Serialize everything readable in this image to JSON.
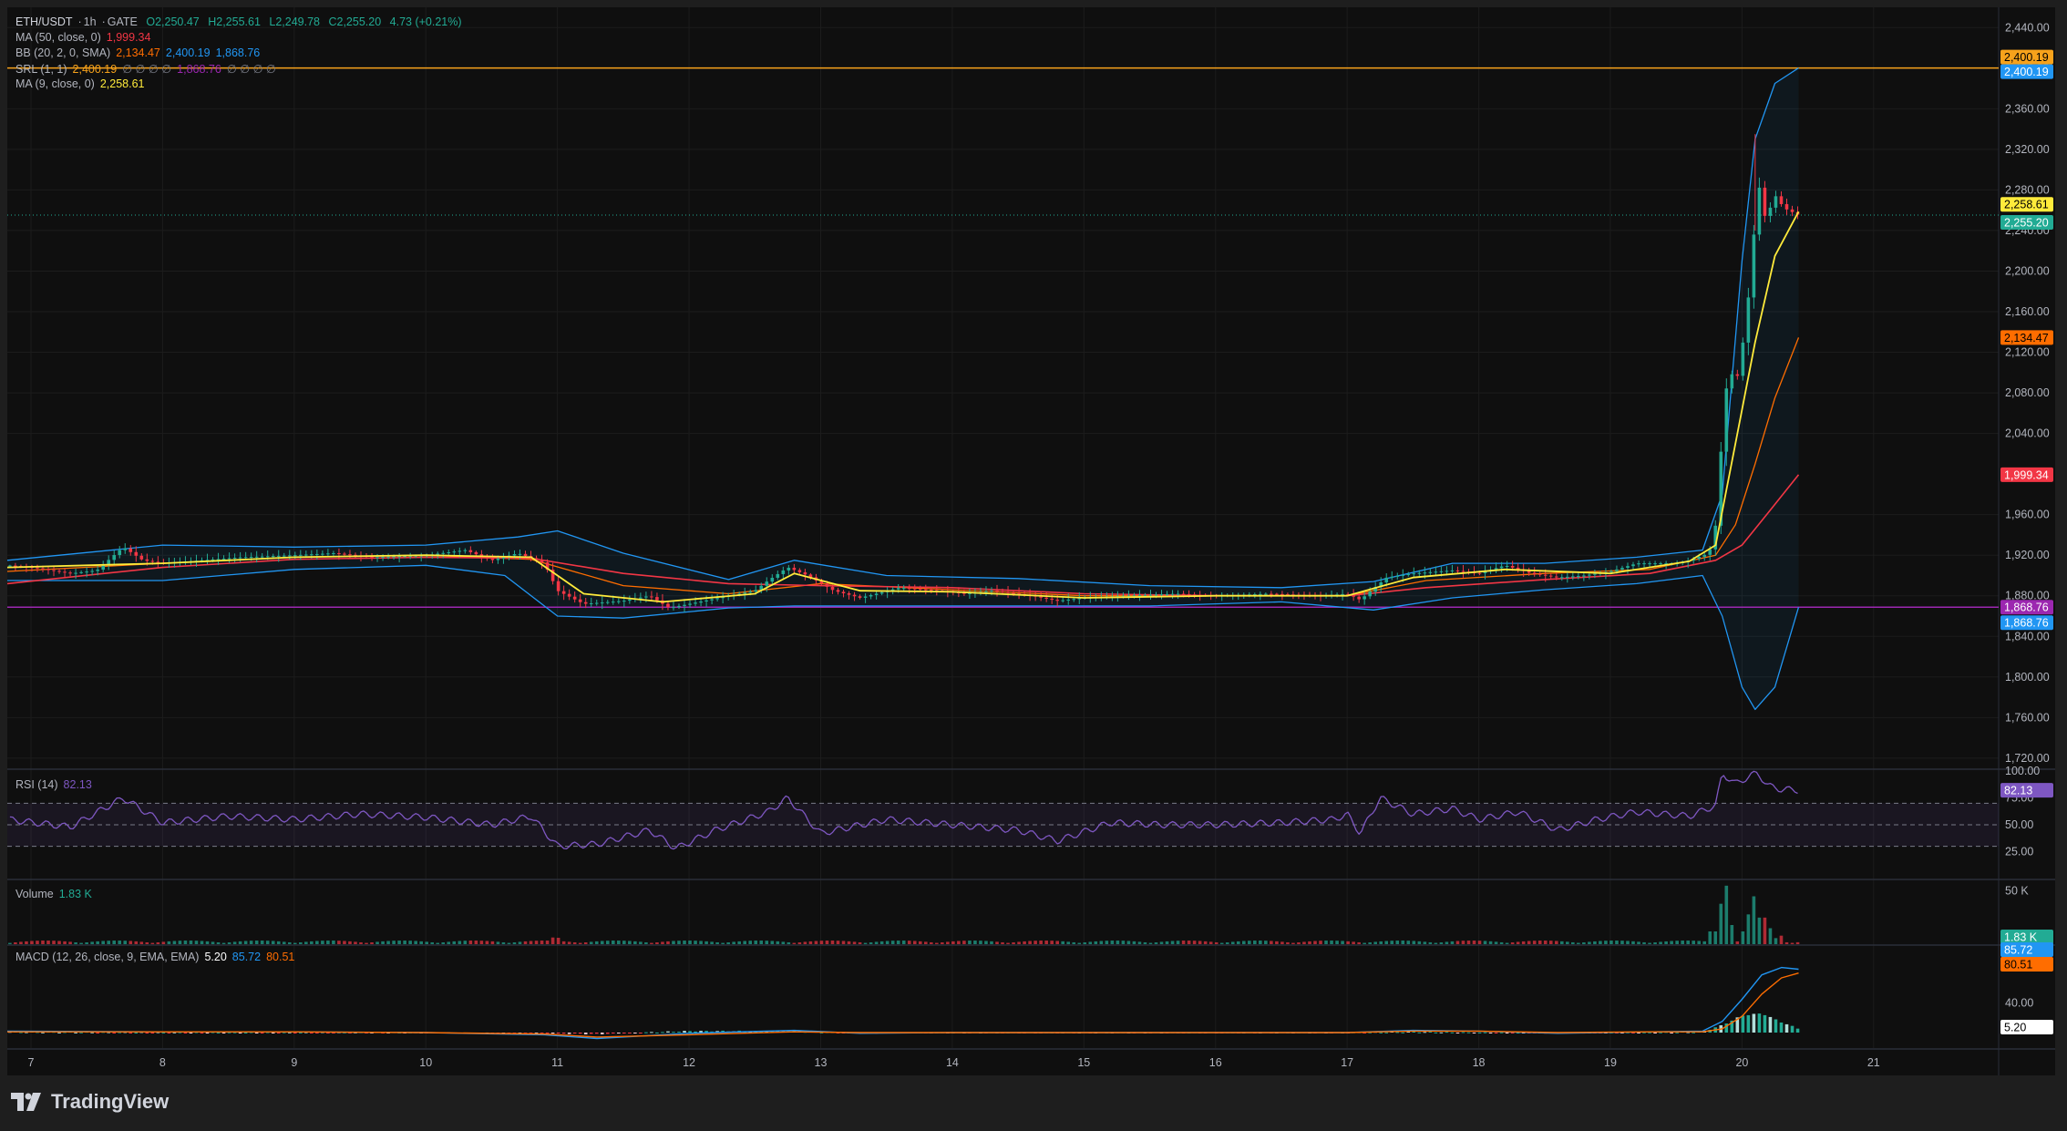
{
  "header": {
    "symbol": "ETH/USDT",
    "interval": "1h",
    "exchange": "GATE",
    "open": "O2,250.47",
    "high": "H2,255.61",
    "low": "L2,249.78",
    "close": "C2,255.20",
    "change": "4.73 (+0.21%)"
  },
  "indicators": {
    "ma50": {
      "label": "MA (50, close, 0)",
      "value": "1,999.34"
    },
    "bb": {
      "label": "BB (20, 2, 0, SMA)",
      "basis": "2,134.47",
      "upper": "2,400.19",
      "lower": "1,868.76"
    },
    "srl": {
      "label": "SRL (1, 1)",
      "v1": "2,400.19",
      "zeros1": "∅ ∅ ∅ ∅",
      "v2": "1,868.76",
      "zeros2": "∅ ∅ ∅ ∅"
    },
    "ma9": {
      "label": "MA (9, close, 0)",
      "value": "2,258.61"
    }
  },
  "rsi": {
    "label": "RSI (14)",
    "value": "82.13"
  },
  "volume": {
    "label": "Volume",
    "value": "1.83 K"
  },
  "macd": {
    "label": "MACD (12, 26, close, 9, EMA, EMA)",
    "hist": "5.20",
    "macd": "85.72",
    "signal": "80.51"
  },
  "price_axis": [
    "2,440.00",
    "2,400.00",
    "2,360.00",
    "2,320.00",
    "2,280.00",
    "2,240.00",
    "2,200.00",
    "2,160.00",
    "2,120.00",
    "2,080.00",
    "2,040.00",
    "1,960.00",
    "1,920.00",
    "1,880.00",
    "1,840.00",
    "1,800.00",
    "1,760.00",
    "1,720.00"
  ],
  "rsi_axis": [
    "100.00",
    "75.00",
    "50.00",
    "25.00"
  ],
  "volume_axis": [
    "50 K"
  ],
  "macd_axis": [
    "40.00"
  ],
  "price_tags": [
    {
      "text": "2,400.19",
      "color": "#f7a21b",
      "text_color": "#000000"
    },
    {
      "text": "2,400.19",
      "color": "#2196f3",
      "text_color": "#ffffff"
    },
    {
      "text": "2,258.61",
      "color": "#ffeb3b",
      "text_color": "#000000"
    },
    {
      "text": "2,255.20",
      "color": "#22ab94",
      "text_color": "#ffffff"
    },
    {
      "text": "2,134.47",
      "color": "#ff6d00",
      "text_color": "#000000"
    },
    {
      "text": "1,999.34",
      "color": "#f23645",
      "text_color": "#ffffff"
    },
    {
      "text": "1,868.76",
      "color": "#9c27b0",
      "text_color": "#ffffff"
    },
    {
      "text": "1,868.76",
      "color": "#2196f3",
      "text_color": "#ffffff"
    }
  ],
  "pane_tags": {
    "rsi": {
      "text": "82.13",
      "color": "#7e57c2"
    },
    "volume": {
      "text": "1.83 K",
      "color": "#22ab94"
    },
    "macd_line": {
      "text": "85.72",
      "color": "#2196f3"
    },
    "macd_signal": {
      "text": "80.51",
      "color": "#ff6d00"
    },
    "macd_hist": {
      "text": "5.20",
      "color": "#ffffff"
    }
  },
  "time_axis": [
    "7",
    "8",
    "9",
    "10",
    "11",
    "12",
    "13",
    "14",
    "15",
    "16",
    "17",
    "18",
    "19",
    "20",
    "21"
  ],
  "branding": "TradingView",
  "colors": {
    "up": "#22ab94",
    "down": "#f23645",
    "ma9": "#ffeb3b",
    "ma50": "#f23645",
    "bb_basis": "#ff6d00",
    "bb_band": "#2196f3",
    "srl_upper": "#f7a21b",
    "srl_lower": "#9c27b0",
    "rsi": "#7e57c2"
  },
  "chart_data": {
    "type": "candlestick",
    "price_range": [
      1710,
      2460
    ],
    "x_domain_days": [
      6.82,
      21.95
    ],
    "grid": true,
    "key_levels": {
      "srl_upper": 2400.19,
      "srl_lower": 1868.76,
      "last_close": 2255.2
    },
    "price_path": [
      [
        6.82,
        1910
      ],
      [
        7.0,
        1908
      ],
      [
        7.3,
        1902
      ],
      [
        7.5,
        1905
      ],
      [
        7.7,
        1928
      ],
      [
        7.85,
        1915
      ],
      [
        8.0,
        1912
      ],
      [
        8.3,
        1915
      ],
      [
        8.6,
        1918
      ],
      [
        9.0,
        1920
      ],
      [
        9.3,
        1922
      ],
      [
        9.6,
        1918
      ],
      [
        10.0,
        1920
      ],
      [
        10.3,
        1925
      ],
      [
        10.5,
        1915
      ],
      [
        10.7,
        1922
      ],
      [
        10.9,
        1912
      ],
      [
        11.0,
        1885
      ],
      [
        11.2,
        1872
      ],
      [
        11.5,
        1875
      ],
      [
        11.7,
        1880
      ],
      [
        11.85,
        1868
      ],
      [
        12.0,
        1872
      ],
      [
        12.3,
        1880
      ],
      [
        12.5,
        1885
      ],
      [
        12.6,
        1895
      ],
      [
        12.75,
        1908
      ],
      [
        12.9,
        1900
      ],
      [
        13.1,
        1885
      ],
      [
        13.3,
        1878
      ],
      [
        13.6,
        1888
      ],
      [
        13.9,
        1885
      ],
      [
        14.1,
        1882
      ],
      [
        14.3,
        1885
      ],
      [
        14.6,
        1880
      ],
      [
        14.8,
        1875
      ],
      [
        15.0,
        1878
      ],
      [
        15.3,
        1880
      ],
      [
        15.7,
        1882
      ],
      [
        16.0,
        1880
      ],
      [
        16.4,
        1882
      ],
      [
        16.8,
        1880
      ],
      [
        17.0,
        1882
      ],
      [
        17.1,
        1876
      ],
      [
        17.3,
        1898
      ],
      [
        17.5,
        1902
      ],
      [
        17.8,
        1905
      ],
      [
        18.0,
        1902
      ],
      [
        18.2,
        1910
      ],
      [
        18.4,
        1902
      ],
      [
        18.6,
        1898
      ],
      [
        18.8,
        1900
      ],
      [
        19.0,
        1904
      ],
      [
        19.2,
        1912
      ],
      [
        19.5,
        1912
      ],
      [
        19.6,
        1915
      ],
      [
        19.75,
        1922
      ],
      [
        19.8,
        1950
      ],
      [
        19.85,
        2040
      ],
      [
        19.9,
        2110
      ],
      [
        19.95,
        2085
      ],
      [
        20.02,
        2140
      ],
      [
        20.07,
        2200
      ],
      [
        20.12,
        2290
      ],
      [
        20.18,
        2250
      ],
      [
        20.25,
        2275
      ],
      [
        20.32,
        2262
      ],
      [
        20.43,
        2255.2
      ]
    ],
    "ma9": [
      [
        6.82,
        1908
      ],
      [
        8.0,
        1912
      ],
      [
        9.0,
        1918
      ],
      [
        10.0,
        1920
      ],
      [
        10.8,
        1918
      ],
      [
        11.2,
        1882
      ],
      [
        11.8,
        1874
      ],
      [
        12.5,
        1882
      ],
      [
        12.8,
        1902
      ],
      [
        13.3,
        1885
      ],
      [
        14.0,
        1884
      ],
      [
        15.0,
        1878
      ],
      [
        16.0,
        1880
      ],
      [
        17.0,
        1880
      ],
      [
        17.5,
        1898
      ],
      [
        18.2,
        1906
      ],
      [
        19.0,
        1902
      ],
      [
        19.6,
        1914
      ],
      [
        19.8,
        1930
      ],
      [
        19.95,
        2030
      ],
      [
        20.1,
        2130
      ],
      [
        20.25,
        2215
      ],
      [
        20.43,
        2258.61
      ]
    ],
    "ma50": [
      [
        6.82,
        1892
      ],
      [
        8.0,
        1908
      ],
      [
        9.0,
        1916
      ],
      [
        10.0,
        1918
      ],
      [
        10.8,
        1917
      ],
      [
        11.5,
        1902
      ],
      [
        12.3,
        1892
      ],
      [
        13.0,
        1890
      ],
      [
        14.0,
        1888
      ],
      [
        15.0,
        1882
      ],
      [
        16.0,
        1880
      ],
      [
        17.0,
        1880
      ],
      [
        17.6,
        1888
      ],
      [
        18.5,
        1896
      ],
      [
        19.3,
        1902
      ],
      [
        19.8,
        1915
      ],
      [
        20.0,
        1930
      ],
      [
        20.2,
        1962
      ],
      [
        20.43,
        1999.34
      ]
    ],
    "bb_basis": [
      [
        6.82,
        1904
      ],
      [
        8.0,
        1912
      ],
      [
        9.0,
        1918
      ],
      [
        10.0,
        1920
      ],
      [
        10.8,
        1916
      ],
      [
        11.5,
        1890
      ],
      [
        12.3,
        1882
      ],
      [
        13.0,
        1892
      ],
      [
        14.0,
        1886
      ],
      [
        15.0,
        1880
      ],
      [
        16.0,
        1880
      ],
      [
        17.0,
        1880
      ],
      [
        17.6,
        1895
      ],
      [
        18.5,
        1902
      ],
      [
        19.3,
        1906
      ],
      [
        19.8,
        1920
      ],
      [
        19.95,
        1950
      ],
      [
        20.1,
        2010
      ],
      [
        20.25,
        2075
      ],
      [
        20.43,
        2134.47
      ]
    ],
    "bb_upper": [
      [
        6.82,
        1915
      ],
      [
        8.0,
        1930
      ],
      [
        9.0,
        1928
      ],
      [
        10.0,
        1930
      ],
      [
        10.7,
        1938
      ],
      [
        11.0,
        1944
      ],
      [
        11.5,
        1922
      ],
      [
        12.3,
        1896
      ],
      [
        12.8,
        1915
      ],
      [
        13.5,
        1900
      ],
      [
        14.5,
        1897
      ],
      [
        15.5,
        1890
      ],
      [
        16.5,
        1888
      ],
      [
        17.2,
        1894
      ],
      [
        17.8,
        1912
      ],
      [
        18.5,
        1912
      ],
      [
        19.2,
        1918
      ],
      [
        19.7,
        1925
      ],
      [
        19.85,
        1980
      ],
      [
        20.0,
        2210
      ],
      [
        20.1,
        2330
      ],
      [
        20.25,
        2385
      ],
      [
        20.43,
        2400.19
      ]
    ],
    "bb_lower": [
      [
        6.82,
        1895
      ],
      [
        8.0,
        1895
      ],
      [
        9.0,
        1906
      ],
      [
        10.0,
        1910
      ],
      [
        10.6,
        1900
      ],
      [
        11.0,
        1860
      ],
      [
        11.5,
        1858
      ],
      [
        12.3,
        1868
      ],
      [
        12.8,
        1870
      ],
      [
        13.5,
        1870
      ],
      [
        14.5,
        1870
      ],
      [
        15.5,
        1870
      ],
      [
        16.5,
        1874
      ],
      [
        17.2,
        1866
      ],
      [
        17.8,
        1878
      ],
      [
        18.5,
        1886
      ],
      [
        19.2,
        1892
      ],
      [
        19.7,
        1900
      ],
      [
        19.85,
        1860
      ],
      [
        20.0,
        1790
      ],
      [
        20.1,
        1768
      ],
      [
        20.25,
        1790
      ],
      [
        20.43,
        1868.76
      ]
    ],
    "rsi": {
      "range": [
        0,
        100
      ],
      "bands": [
        70,
        50,
        30
      ],
      "last": 82.13,
      "path": [
        [
          6.82,
          55
        ],
        [
          7.3,
          48
        ],
        [
          7.7,
          75
        ],
        [
          8.0,
          52
        ],
        [
          8.5,
          58
        ],
        [
          9.0,
          55
        ],
        [
          9.5,
          60
        ],
        [
          10.0,
          57
        ],
        [
          10.5,
          50
        ],
        [
          10.8,
          58
        ],
        [
          11.0,
          30
        ],
        [
          11.3,
          32
        ],
        [
          11.7,
          45
        ],
        [
          11.9,
          28
        ],
        [
          12.2,
          45
        ],
        [
          12.6,
          62
        ],
        [
          12.75,
          75
        ],
        [
          13.0,
          42
        ],
        [
          13.5,
          55
        ],
        [
          14.0,
          50
        ],
        [
          14.5,
          45
        ],
        [
          14.8,
          35
        ],
        [
          15.2,
          52
        ],
        [
          15.6,
          50
        ],
        [
          16.0,
          50
        ],
        [
          16.5,
          52
        ],
        [
          16.9,
          55
        ],
        [
          17.0,
          60
        ],
        [
          17.1,
          42
        ],
        [
          17.25,
          75
        ],
        [
          17.5,
          60
        ],
        [
          17.8,
          65
        ],
        [
          18.0,
          55
        ],
        [
          18.3,
          62
        ],
        [
          18.6,
          45
        ],
        [
          18.9,
          55
        ],
        [
          19.2,
          62
        ],
        [
          19.6,
          58
        ],
        [
          19.8,
          68
        ],
        [
          19.85,
          98
        ],
        [
          19.95,
          88
        ],
        [
          20.07,
          96
        ],
        [
          20.12,
          98
        ],
        [
          20.2,
          86
        ],
        [
          20.3,
          83
        ],
        [
          20.43,
          82.13
        ]
      ]
    },
    "volume": {
      "unit": "K",
      "last": 1.83,
      "spikes": [
        [
          19.78,
          12
        ],
        [
          19.83,
          38
        ],
        [
          19.88,
          55
        ],
        [
          19.93,
          18
        ],
        [
          20.0,
          12
        ],
        [
          20.05,
          28
        ],
        [
          20.1,
          45
        ],
        [
          20.15,
          25
        ],
        [
          20.2,
          15
        ],
        [
          20.3,
          8
        ],
        [
          20.43,
          1.83
        ]
      ]
    },
    "macd": {
      "last_macd": 85.72,
      "last_signal": 80.51,
      "last_hist": 5.2,
      "macd_path": [
        [
          6.82,
          2
        ],
        [
          8.0,
          1
        ],
        [
          9.0,
          1
        ],
        [
          10.0,
          0
        ],
        [
          10.9,
          -3
        ],
        [
          11.3,
          -8
        ],
        [
          12.0,
          -1
        ],
        [
          12.8,
          3
        ],
        [
          13.3,
          -1
        ],
        [
          14.0,
          0
        ],
        [
          16.0,
          0
        ],
        [
          17.0,
          0
        ],
        [
          17.5,
          3
        ],
        [
          18.0,
          2
        ],
        [
          18.6,
          -1
        ],
        [
          19.3,
          1
        ],
        [
          19.7,
          2
        ],
        [
          19.85,
          15
        ],
        [
          20.0,
          45
        ],
        [
          20.15,
          78
        ],
        [
          20.3,
          88
        ],
        [
          20.43,
          85.72
        ]
      ],
      "signal_path": [
        [
          6.82,
          1
        ],
        [
          8.0,
          1
        ],
        [
          9.0,
          1
        ],
        [
          10.0,
          0
        ],
        [
          10.9,
          -2
        ],
        [
          11.3,
          -6
        ],
        [
          12.0,
          -3
        ],
        [
          12.8,
          1
        ],
        [
          13.3,
          0
        ],
        [
          14.0,
          0
        ],
        [
          16.0,
          0
        ],
        [
          17.0,
          0
        ],
        [
          17.5,
          2
        ],
        [
          18.0,
          2
        ],
        [
          18.6,
          0
        ],
        [
          19.3,
          1
        ],
        [
          19.7,
          1
        ],
        [
          19.85,
          5
        ],
        [
          20.0,
          22
        ],
        [
          20.15,
          52
        ],
        [
          20.3,
          74
        ],
        [
          20.43,
          80.51
        ]
      ]
    }
  }
}
